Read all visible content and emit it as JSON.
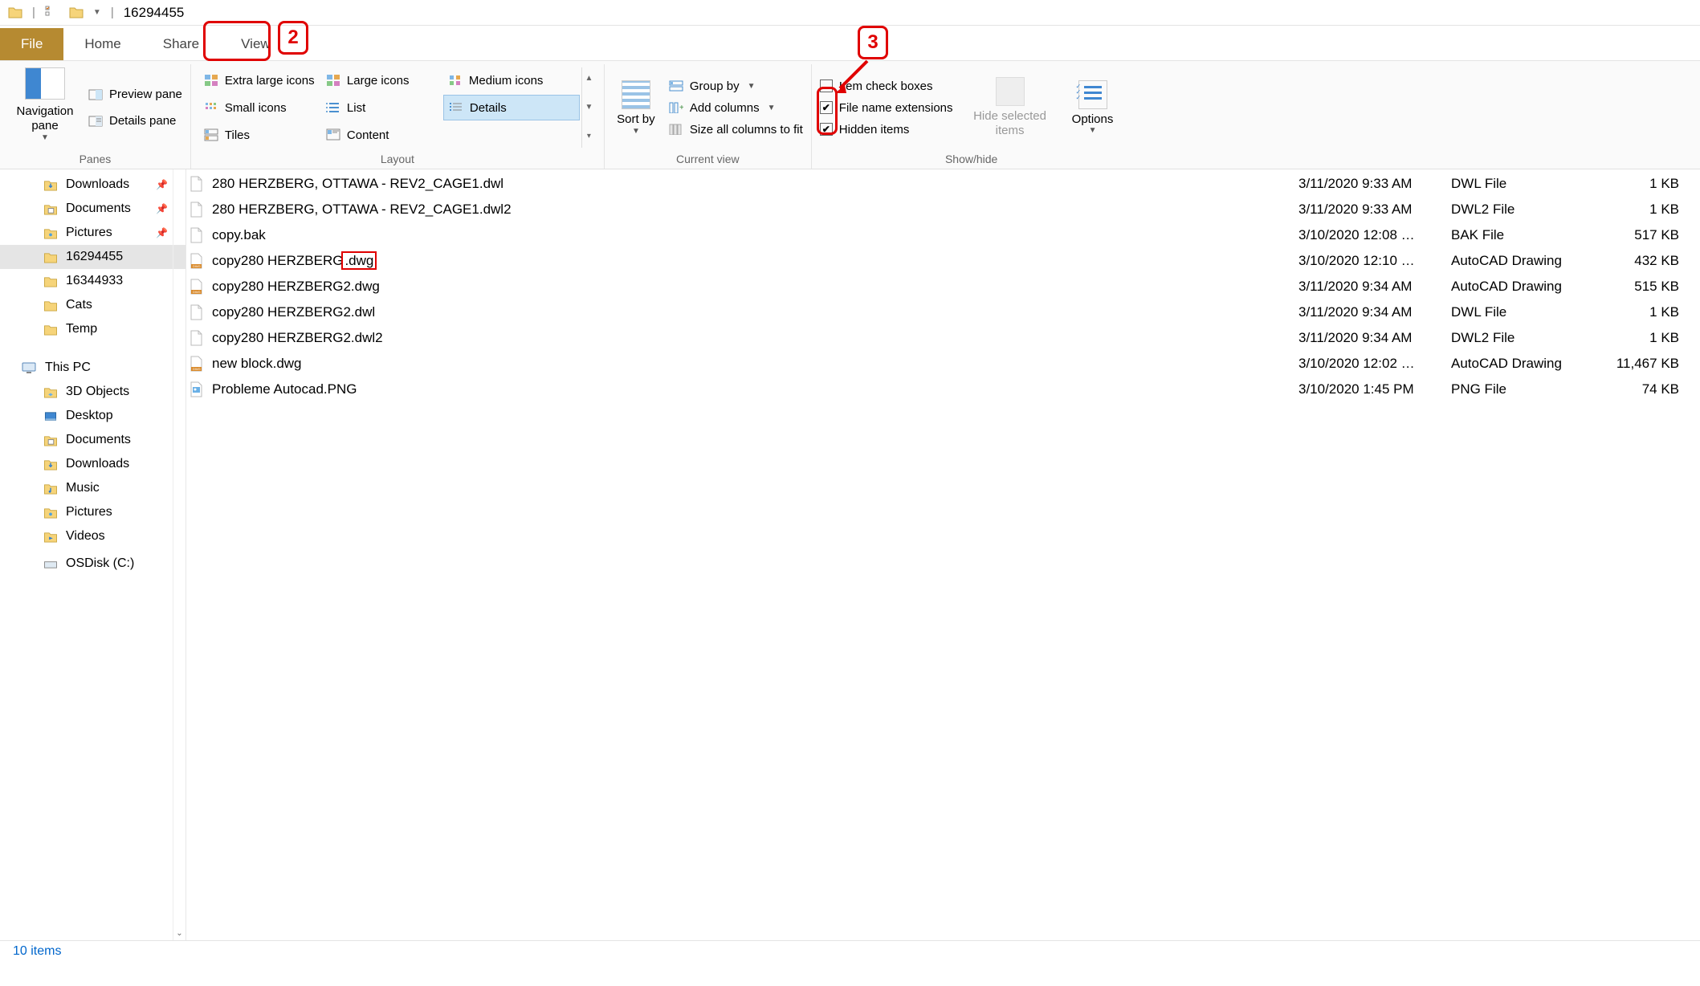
{
  "titlebar": {
    "folder_name": "16294455"
  },
  "tabs": {
    "file": "File",
    "home": "Home",
    "share": "Share",
    "view": "View"
  },
  "callouts": {
    "num2": "2",
    "num3": "3"
  },
  "ribbon": {
    "panes": {
      "nav": "Navigation pane",
      "preview": "Preview pane",
      "details": "Details pane",
      "label": "Panes"
    },
    "layout": {
      "xl": "Extra large icons",
      "large": "Large icons",
      "medium": "Medium icons",
      "small": "Small icons",
      "list": "List",
      "details": "Details",
      "tiles": "Tiles",
      "content": "Content",
      "label": "Layout"
    },
    "current": {
      "sort": "Sort by",
      "group": "Group by",
      "addcols": "Add columns",
      "sizecols": "Size all columns to fit",
      "label": "Current view"
    },
    "show": {
      "check": "Item check boxes",
      "ext": "File name extensions",
      "hidden": "Hidden items",
      "hidesel": "Hide selected items",
      "options": "Options",
      "label": "Show/hide"
    }
  },
  "sidebar": {
    "quick": [
      {
        "label": "Downloads",
        "pinned": true,
        "icon": "folder-dl"
      },
      {
        "label": "Documents",
        "pinned": true,
        "icon": "folder-doc"
      },
      {
        "label": "Pictures",
        "pinned": true,
        "icon": "folder-pic"
      },
      {
        "label": "16294455",
        "pinned": false,
        "icon": "folder",
        "selected": true
      },
      {
        "label": "16344933",
        "pinned": false,
        "icon": "folder"
      },
      {
        "label": "Cats",
        "pinned": false,
        "icon": "folder"
      },
      {
        "label": "Temp",
        "pinned": false,
        "icon": "folder"
      }
    ],
    "thispc": "This PC",
    "pc_items": [
      {
        "label": "3D Objects",
        "icon": "folder-3d"
      },
      {
        "label": "Desktop",
        "icon": "folder-desk"
      },
      {
        "label": "Documents",
        "icon": "folder-doc"
      },
      {
        "label": "Downloads",
        "icon": "folder-dl"
      },
      {
        "label": "Music",
        "icon": "folder-music"
      },
      {
        "label": "Pictures",
        "icon": "folder-pic"
      },
      {
        "label": "Videos",
        "icon": "folder-vid"
      }
    ],
    "cut": "OSDisk (C:)"
  },
  "files": [
    {
      "name_pre": "280 HERZBERG, OTTAWA - REV2_CAGE1.dwl",
      "date": "3/11/2020 9:33 AM",
      "type": "DWL File",
      "size": "1 KB",
      "icon": "blank"
    },
    {
      "name_pre": "280 HERZBERG, OTTAWA - REV2_CAGE1.dwl2",
      "date": "3/11/2020 9:33 AM",
      "type": "DWL2 File",
      "size": "1 KB",
      "icon": "blank"
    },
    {
      "name_pre": "copy.bak",
      "date": "3/10/2020 12:08 …",
      "type": "BAK File",
      "size": "517 KB",
      "icon": "blank"
    },
    {
      "name_pre": "copy280 HERZBERG",
      "name_hl": ".dwg",
      "date": "3/10/2020 12:10 …",
      "type": "AutoCAD Drawing",
      "size": "432 KB",
      "icon": "dwg"
    },
    {
      "name_pre": "copy280 HERZBERG2.dwg",
      "date": "3/11/2020 9:34 AM",
      "type": "AutoCAD Drawing",
      "size": "515 KB",
      "icon": "dwg"
    },
    {
      "name_pre": "copy280 HERZBERG2.dwl",
      "date": "3/11/2020 9:34 AM",
      "type": "DWL File",
      "size": "1 KB",
      "icon": "blank"
    },
    {
      "name_pre": "copy280 HERZBERG2.dwl2",
      "date": "3/11/2020 9:34 AM",
      "type": "DWL2 File",
      "size": "1 KB",
      "icon": "blank"
    },
    {
      "name_pre": "new block.dwg",
      "date": "3/10/2020 12:02 …",
      "type": "AutoCAD Drawing",
      "size": "11,467 KB",
      "icon": "dwg"
    },
    {
      "name_pre": "Probleme Autocad.PNG",
      "date": "3/10/2020 1:45 PM",
      "type": "PNG File",
      "size": "74 KB",
      "icon": "png"
    }
  ],
  "status": {
    "count": "10 items"
  }
}
